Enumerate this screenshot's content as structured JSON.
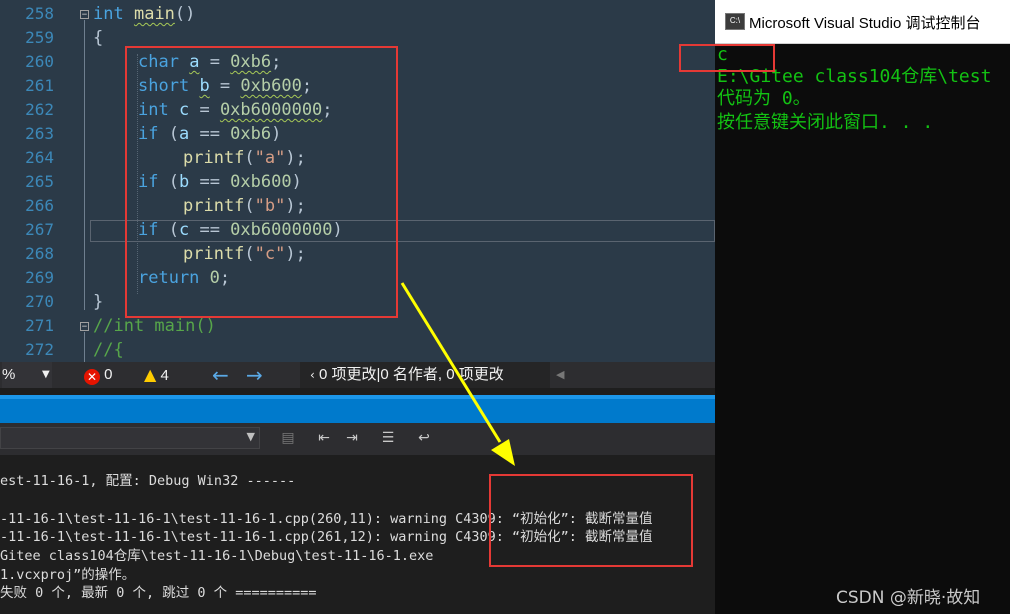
{
  "editor": {
    "line_numbers": [
      "258",
      "259",
      "260",
      "261",
      "262",
      "263",
      "264",
      "265",
      "266",
      "267",
      "268",
      "269",
      "270",
      "271",
      "272"
    ]
  },
  "code": {
    "l258_kw": "int",
    "l258_fn": "main",
    "l258_rest": "()",
    "l259": "{",
    "l260_kw": "char",
    "l260_var": "a",
    "l260_eq": " = ",
    "l260_num": "0xb6",
    "l260_end": ";",
    "l261_kw": "short",
    "l261_var": "b",
    "l261_eq": " = ",
    "l261_num": "0xb600",
    "l261_end": ";",
    "l262_kw": "int",
    "l262_var": "c",
    "l262_eq": " = ",
    "l262_num": "0xb6000000",
    "l262_end": ";",
    "l263_kw": "if",
    "l263_a": " (",
    "l263_var": "a",
    "l263_b": " == ",
    "l263_num": "0xb6",
    "l263_c": ")",
    "l264_fn": "printf",
    "l264_a": "(",
    "l264_str": "\"a\"",
    "l264_b": ");",
    "l265_kw": "if",
    "l265_a": " (",
    "l265_var": "b",
    "l265_b": " == ",
    "l265_num": "0xb600",
    "l265_c": ")",
    "l266_fn": "printf",
    "l266_a": "(",
    "l266_str": "\"b\"",
    "l266_b": ");",
    "l267_kw": "if",
    "l267_a": " (",
    "l267_var": "c",
    "l267_b": " == ",
    "l267_num": "0xb6000000",
    "l267_c": ")",
    "l268_fn": "printf",
    "l268_a": "(",
    "l268_str": "\"c\"",
    "l268_b": ");",
    "l269_kw": "return",
    "l269_num": " 0",
    "l269_end": ";",
    "l270": "}",
    "l271": "//int main()",
    "l272": "//{"
  },
  "editor_status": {
    "zoom_suffix": "%",
    "errors": "0",
    "warnings": "4",
    "changes": "0 项更改|0 名作者, 0 项更改"
  },
  "output": {
    "lines": [
      "est-11-16-1, 配置: Debug Win32 ------",
      "",
      "-11-16-1\\test-11-16-1\\test-11-16-1.cpp(260,11): warning C4309: “初始化”: 截断常量值",
      "-11-16-1\\test-11-16-1\\test-11-16-1.cpp(261,12): warning C4309: “初始化”: 截断常量值",
      "Gitee class104仓库\\test-11-16-1\\Debug\\test-11-16-1.exe",
      "1.vcxproj”的操作。",
      "失败 0 个, 最新 0 个, 跳过 0 个 =========="
    ]
  },
  "console": {
    "app_icon": "C:\\",
    "title": "Microsoft Visual Studio 调试控制台",
    "lines": [
      "c",
      "E:\\Gitee class104仓库\\test",
      "代码为 0。",
      "按任意键关闭此窗口. . ."
    ]
  },
  "watermark": "CSDN @新晓·故知",
  "colors": {
    "editor_bg": "#2b3a48",
    "console_text": "#13c213",
    "annotation_red": "#e53935",
    "arrow_yellow": "#ffff00",
    "accent_blue": "#007acc"
  }
}
